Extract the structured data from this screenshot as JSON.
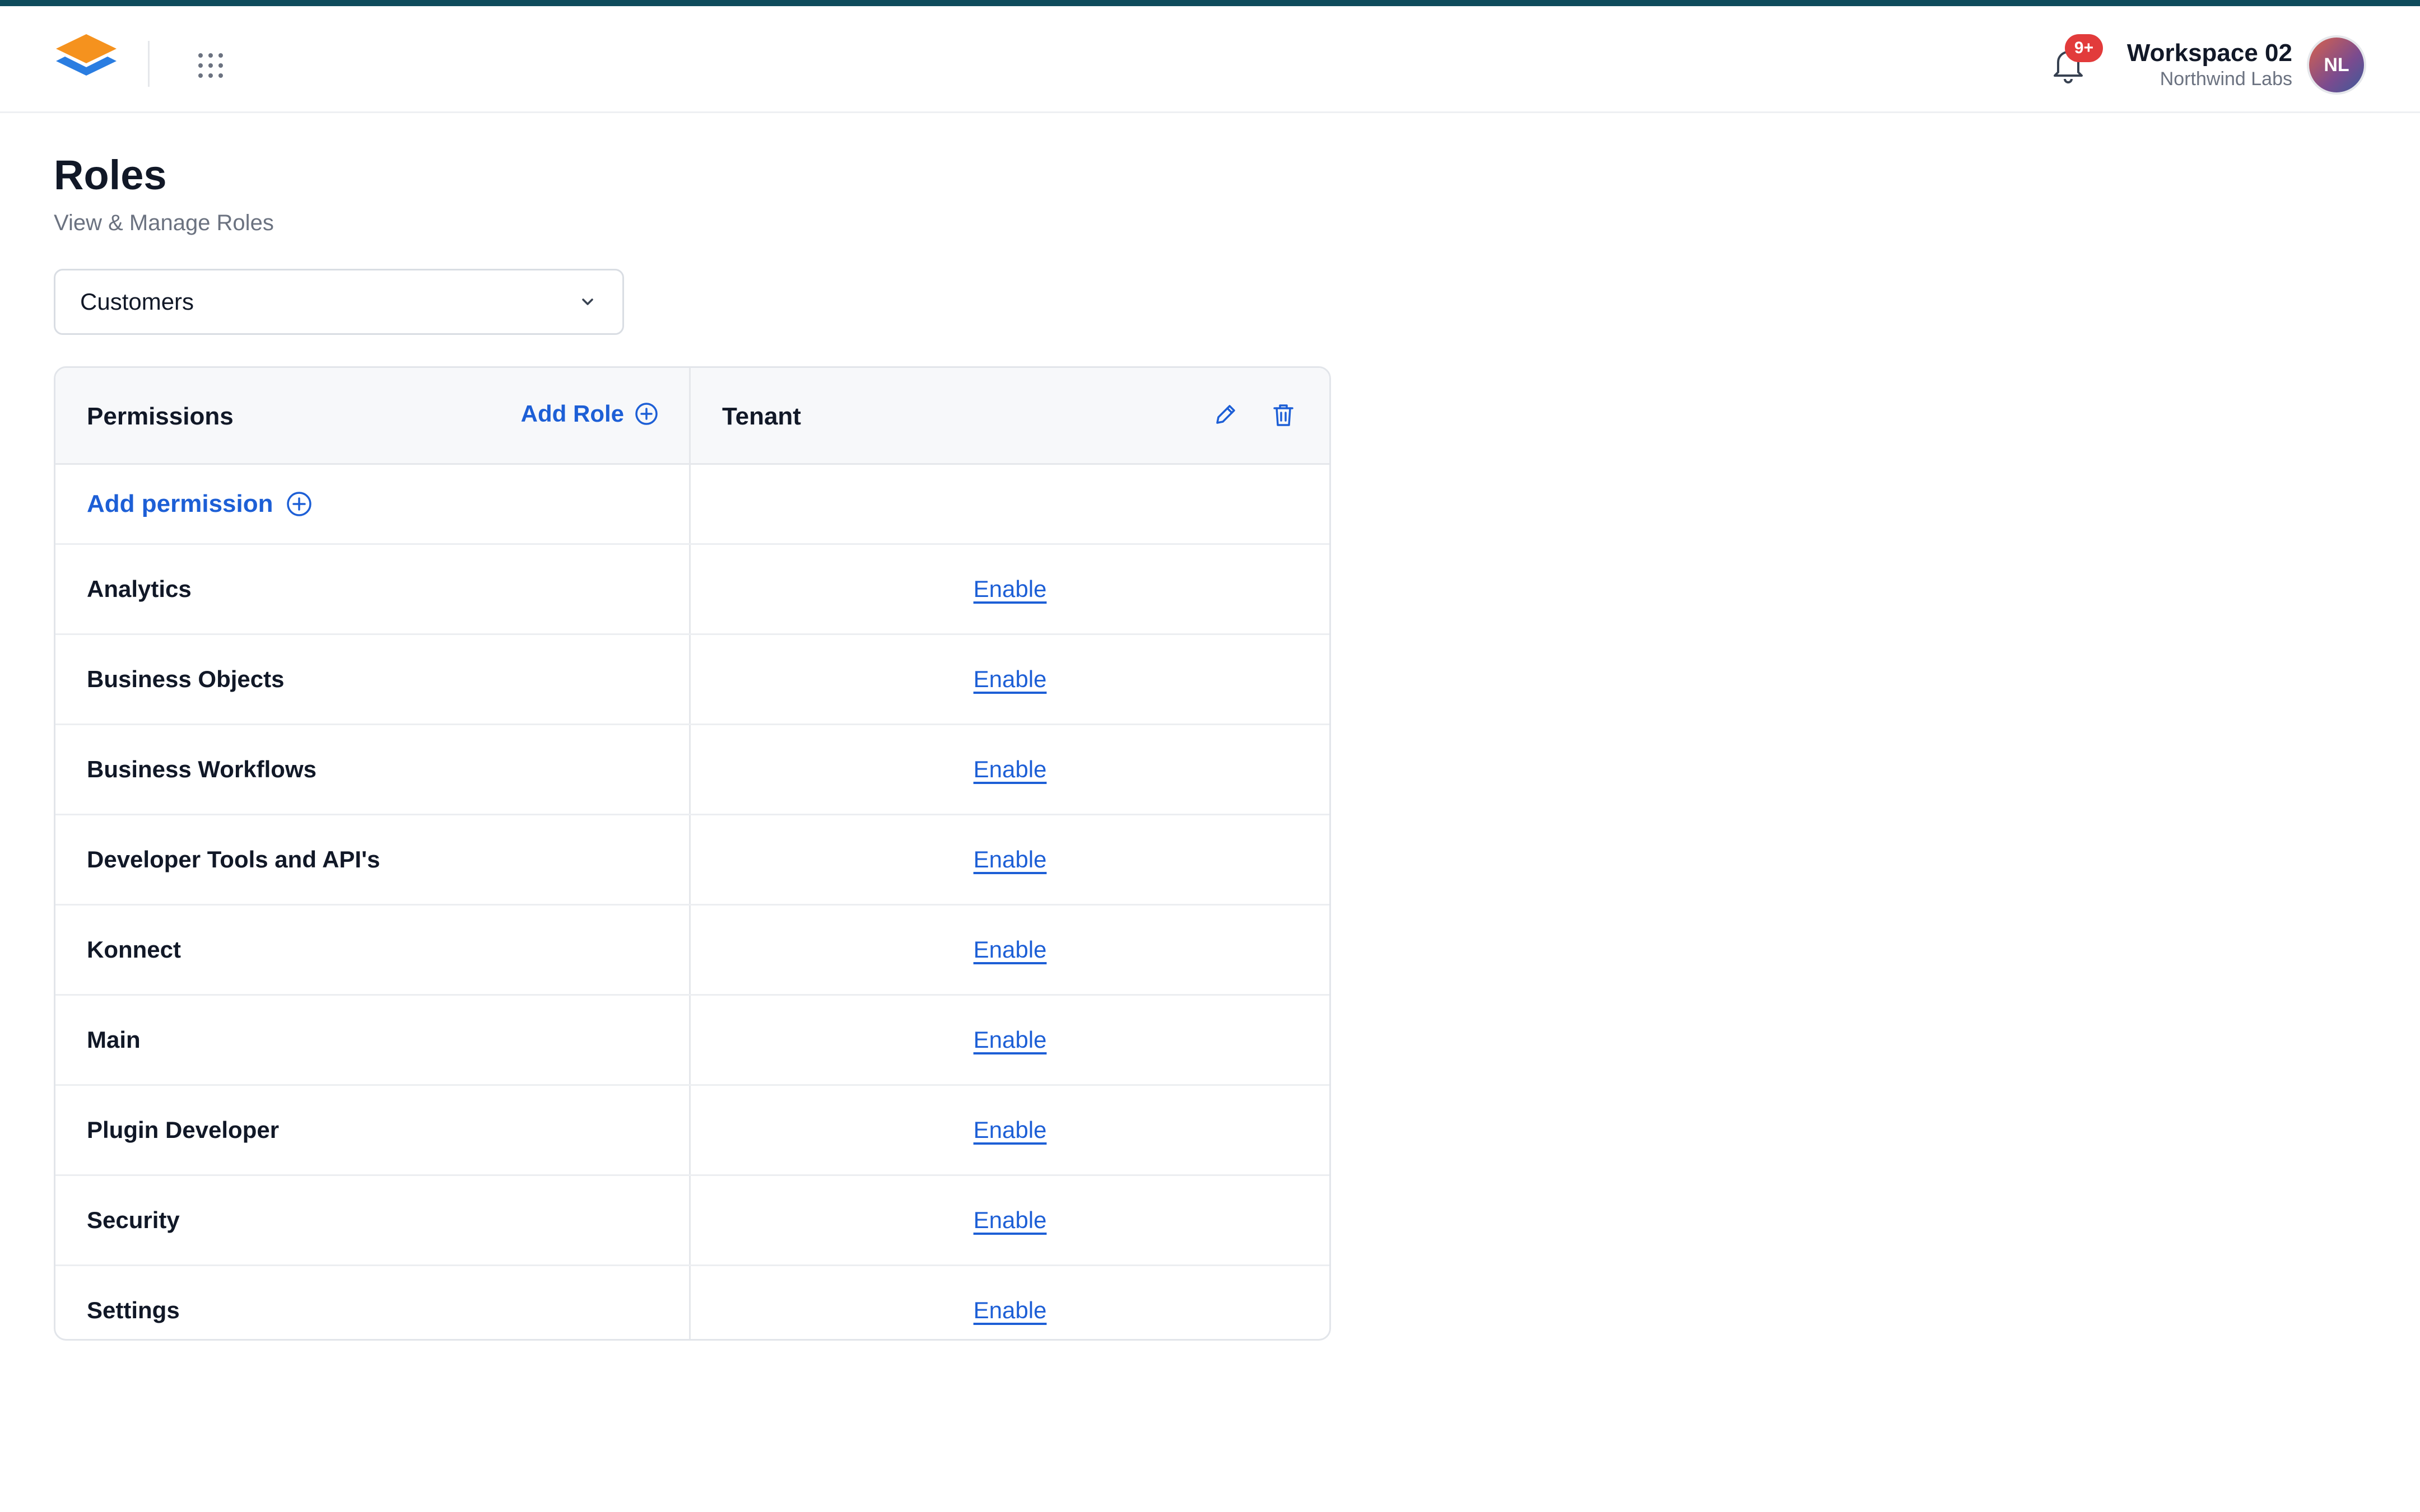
{
  "colors": {
    "accent": "#1d5fd6",
    "topline": "#0f4c5c",
    "badge": "#e23b3b"
  },
  "header": {
    "logo_icon": "stacked-layers-logo",
    "apps_icon": "grid-dots-icon",
    "bell_icon": "bell-icon",
    "notification_badge": "9+",
    "workspace_name": "Workspace 02",
    "workspace_org": "Northwind Labs",
    "avatar_initials": "NL"
  },
  "page": {
    "title": "Roles",
    "subtitle": "View & Manage Roles"
  },
  "selector": {
    "value": "Customers",
    "icon": "chevron-down-icon"
  },
  "table": {
    "permissions_header": "Permissions",
    "add_role_label": "Add Role",
    "role_header": "Tenant",
    "add_permission_label": "Add permission",
    "rows": [
      {
        "label": "Analytics",
        "action": "Enable"
      },
      {
        "label": "Business Objects",
        "action": "Enable"
      },
      {
        "label": "Business Workflows",
        "action": "Enable"
      },
      {
        "label": "Developer Tools and API's",
        "action": "Enable"
      },
      {
        "label": "Konnect",
        "action": "Enable"
      },
      {
        "label": "Main",
        "action": "Enable"
      },
      {
        "label": "Plugin Developer",
        "action": "Enable"
      },
      {
        "label": "Security",
        "action": "Enable"
      },
      {
        "label": "Settings",
        "action": "Enable"
      }
    ]
  }
}
